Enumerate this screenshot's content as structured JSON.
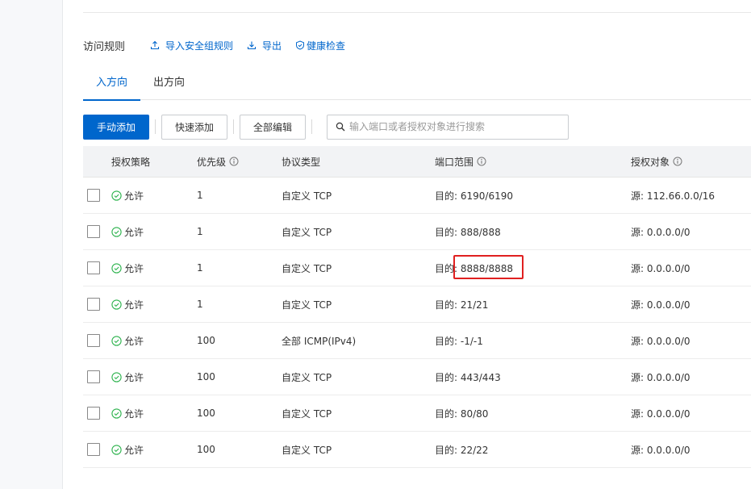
{
  "section": {
    "title": "访问规则",
    "links": {
      "import": "导入安全组规则",
      "export": "导出",
      "health": "健康检查"
    }
  },
  "tabs": [
    {
      "label": "入方向",
      "active": true
    },
    {
      "label": "出方向",
      "active": false
    }
  ],
  "toolbar": {
    "add_label": "手动添加",
    "quick_label": "快速添加",
    "batch_label": "全部编辑",
    "search_placeholder": "输入端口或者授权对象进行搜索"
  },
  "table": {
    "headers": {
      "policy": "授权策略",
      "priority": "优先级",
      "protocol": "协议类型",
      "port": "端口范围",
      "auth": "授权对象"
    },
    "rows": [
      {
        "policy": "允许",
        "priority": "1",
        "protocol": "自定义 TCP",
        "port": "目的: 6190/6190",
        "auth": "源: 112.66.0.0/16"
      },
      {
        "policy": "允许",
        "priority": "1",
        "protocol": "自定义 TCP",
        "port": "目的: 888/888",
        "auth": "源: 0.0.0.0/0"
      },
      {
        "policy": "允许",
        "priority": "1",
        "protocol": "自定义 TCP",
        "port": "目的: 8888/8888",
        "auth": "源: 0.0.0.0/0"
      },
      {
        "policy": "允许",
        "priority": "1",
        "protocol": "自定义 TCP",
        "port": "目的: 21/21",
        "auth": "源: 0.0.0.0/0"
      },
      {
        "policy": "允许",
        "priority": "100",
        "protocol": "全部 ICMP(IPv4)",
        "port": "目的: -1/-1",
        "auth": "源: 0.0.0.0/0"
      },
      {
        "policy": "允许",
        "priority": "100",
        "protocol": "自定义 TCP",
        "port": "目的: 443/443",
        "auth": "源: 0.0.0.0/0"
      },
      {
        "policy": "允许",
        "priority": "100",
        "protocol": "自定义 TCP",
        "port": "目的: 80/80",
        "auth": "源: 0.0.0.0/0"
      },
      {
        "policy": "允许",
        "priority": "100",
        "protocol": "自定义 TCP",
        "port": "目的: 22/22",
        "auth": "源: 0.0.0.0/0"
      }
    ]
  },
  "colors": {
    "accent": "#0066cc",
    "allow": "#2bb24c",
    "highlight": "#e02020"
  }
}
